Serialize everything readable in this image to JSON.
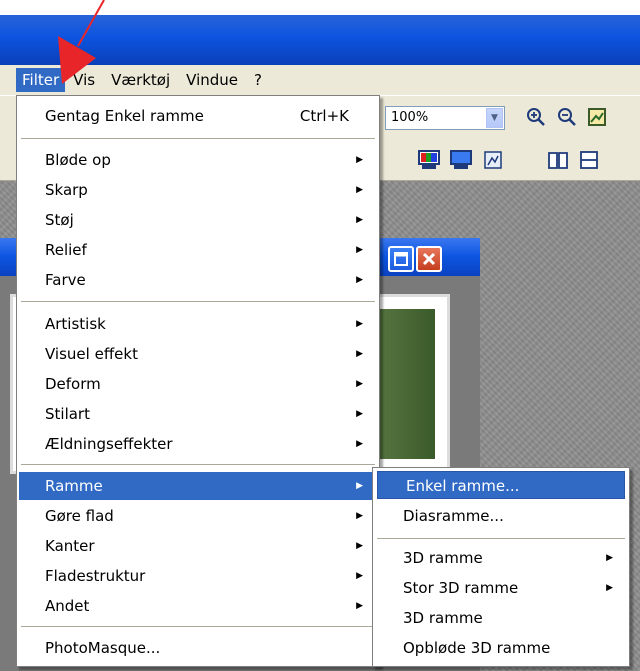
{
  "menubar": {
    "items": [
      {
        "label": "Filter"
      },
      {
        "label": "Vis"
      },
      {
        "label": "Værktøj"
      },
      {
        "label": "Vindue"
      },
      {
        "label": "?"
      }
    ]
  },
  "toolbar": {
    "zoom_value": "100%",
    "icons": [
      "zoom-in-icon",
      "zoom-out-icon",
      "fit-window-icon",
      "color-adjust-icon",
      "monitor-icon",
      "image-icon",
      "book-icon",
      "print-icon"
    ]
  },
  "filter_menu": {
    "repeat": {
      "label": "Gentag Enkel ramme",
      "shortcut": "Ctrl+K"
    },
    "group1": [
      "Bløde op",
      "Skarp",
      "Støj",
      "Relief",
      "Farve"
    ],
    "group2": [
      "Artistisk",
      "Visuel effekt",
      "Deform",
      "Stilart",
      "Ældningseffekter"
    ],
    "group3": [
      "Ramme",
      "Gøre flad",
      "Kanter",
      "Fladestruktur",
      "Andet"
    ],
    "last": "PhotoMasque..."
  },
  "ramme_menu": {
    "group1": [
      "Enkel ramme...",
      "Diasramme..."
    ],
    "group2": [
      "3D ramme",
      "Stor 3D ramme",
      "3D ramme",
      "Opbløde 3D ramme"
    ]
  },
  "colors": {
    "highlight": "#316ac5",
    "titlebar": "#0c54e0",
    "menubar": "#ece9d8",
    "arrow": "#e8262a"
  }
}
